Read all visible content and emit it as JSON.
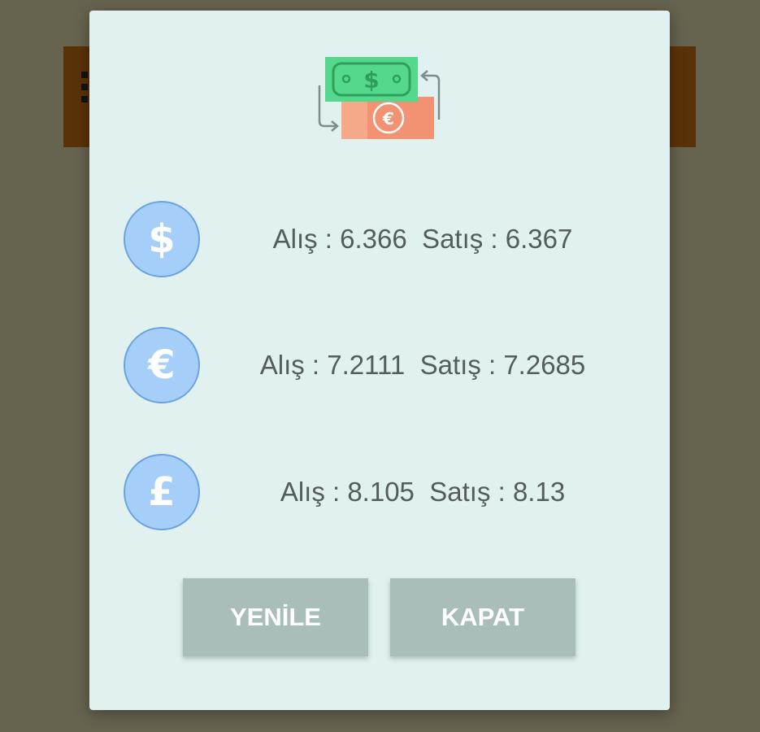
{
  "dialog": {
    "header_icon": "money-exchange-icon",
    "rates": [
      {
        "icon": "dollar-icon",
        "symbol": "$",
        "text": "Alış : 6.366  Satış : 6.367"
      },
      {
        "icon": "euro-icon",
        "symbol": "€",
        "text": "Alış : 7.2111  Satış : 7.2685"
      },
      {
        "icon": "pound-icon",
        "symbol": "£",
        "text": "Alış : 8.105  Satış : 8.13"
      }
    ],
    "buttons": {
      "refresh_label": "YENİLE",
      "close_label": "KAPAT"
    }
  },
  "colors": {
    "dialog_bg": "#e0f1f0",
    "badge_fill": "#a5cff9",
    "button_bg": "#a9bebb",
    "backdrop": "#66634f",
    "text": "#555d5c"
  }
}
